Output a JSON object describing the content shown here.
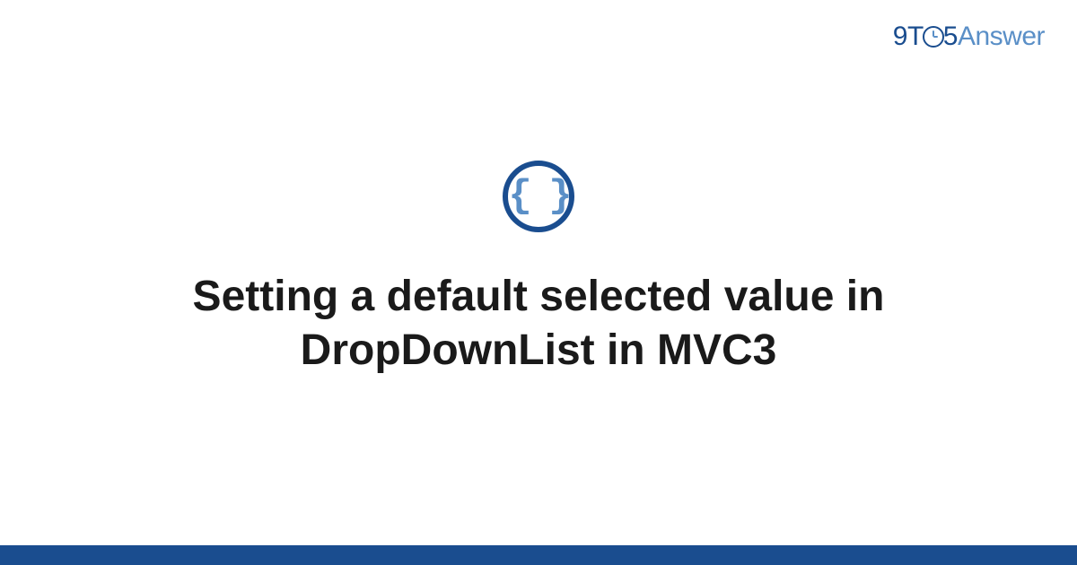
{
  "brand": {
    "part1": "9",
    "part2": "T",
    "part3": "5",
    "part4": "Answer"
  },
  "icon": {
    "name": "code-braces-icon",
    "symbol": "{ }"
  },
  "title": "Setting a default selected value in DropDownList in MVC3",
  "colors": {
    "primary": "#1a4d8f",
    "secondary": "#5a8fc7",
    "text": "#1a1a1a"
  }
}
